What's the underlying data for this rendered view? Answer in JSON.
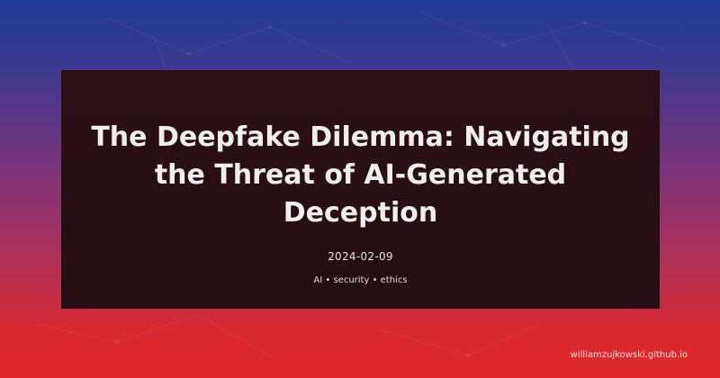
{
  "post": {
    "title": "The Deepfake Dilemma: Navigating the Threat of AI-Generated Deception",
    "date": "2024-02-09",
    "tags": "AI • security • ethics"
  },
  "site": {
    "domain": "williamzujkowski.github.io"
  },
  "colors": {
    "background_top": "#1f3c97",
    "background_bottom": "#e0282a",
    "card_background": "#280e15",
    "text": "#ffffff"
  }
}
